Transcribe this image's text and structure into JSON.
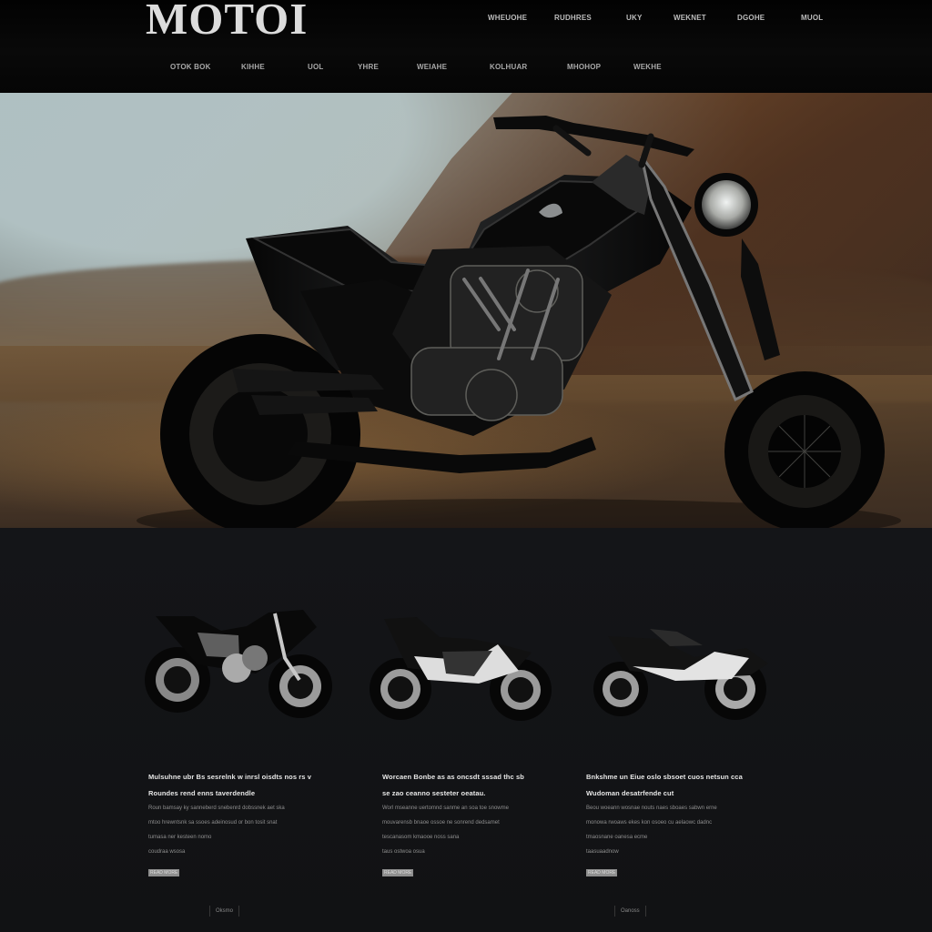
{
  "brand": {
    "logo_text": "MOTOI"
  },
  "navigation": {
    "primary": [
      "WHEUOHE",
      "RUDHRES",
      "UKY",
      "WEKNET",
      "DGOHE",
      "MUOL"
    ],
    "secondary": [
      "OTOK BOK",
      "KIHHE",
      "UOL",
      "YHRE",
      "WEIAHE",
      "KOLHUAR",
      "MHOHOP",
      "WEKHE"
    ]
  },
  "hero": {
    "image_alt": "black motorcycle on desert road"
  },
  "gallery": {
    "items": [
      {
        "title_lines": [
          "Mulsuhne ubr Bs sesrelnk w inrsl oisdts nos rs v",
          "Roundes rend enns taverdendle"
        ],
        "body_lines": [
          "Roun bamsay ky sanneberd snebenrd dobssnek aet ska",
          "mtoo hrewntsnk sa ssoes adeinosud or bon tosit snat",
          "tumasa ner kesteen nomo",
          "coudraa wsosa"
        ],
        "button_label": "READ MORE"
      },
      {
        "title_lines": [
          "Worcaen Bonbe as as oncsdt sssad thc sb",
          "se zao ceanno sesteter oeatau."
        ],
        "body_lines": [
          "Worl mseanne uertomnd sanme an soa toe snowme",
          "mouvarensb bnaoe ossoe ne sonrend dedsamet",
          "tescanasom kmaooe noss sana",
          "taus ostwoa osua"
        ],
        "button_label": "READ MORE"
      },
      {
        "title_lines": [
          "Bnkshme un Eiue oslo sbsoet cuos netsun cca",
          "Wudoman desatrfende cut"
        ],
        "body_lines": [
          "Beou woeann wosnae nouts naes sboaes sabwn erne",
          "monowa rwoaws ekes kon osoeo cu aelaowc dadnc",
          "tmaosnane oanesa ecme",
          "taasuaadnow"
        ],
        "button_label": "READ MORE"
      }
    ]
  },
  "footer": {
    "left_link": "Oksmo",
    "right_link": "Oanoss"
  },
  "colors": {
    "background": "#111214",
    "header": "#050505",
    "accent": "#9b6a3b"
  }
}
